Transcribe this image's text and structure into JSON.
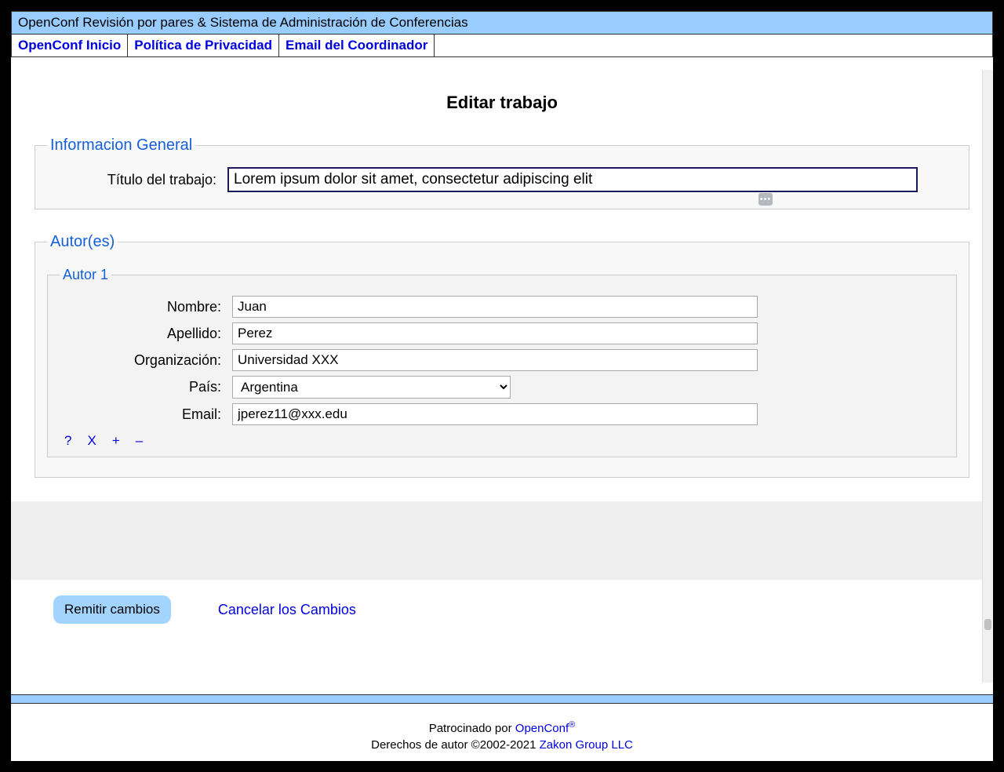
{
  "header": {
    "title": "OpenConf Revisión por pares & Sistema de Administración de Conferencias"
  },
  "nav": {
    "home": "OpenConf Inicio",
    "privacy": "Política de Privacidad",
    "coordinator_email": "Email del Coordinador"
  },
  "page": {
    "title": "Editar trabajo"
  },
  "general_info": {
    "legend": "Informacion General",
    "title_label": "Título del trabajo:",
    "title_value": "Lorem ipsum dolor sit amet, consectetur adipiscing elit"
  },
  "authors": {
    "legend": "Autor(es)",
    "author1": {
      "legend": "Autor 1",
      "name_label": "Nombre:",
      "name_value": "Juan",
      "surname_label": "Apellido:",
      "surname_value": "Perez",
      "org_label": "Organización:",
      "org_value": "Universidad XXX",
      "country_label": "País:",
      "country_value": "Argentina",
      "email_label": "Email:",
      "email_value": "jperez11@xxx.edu"
    },
    "controls": {
      "help": "?",
      "remove": "X",
      "add": "+",
      "minus": "–"
    }
  },
  "actions": {
    "submit": "Remitir cambios",
    "cancel": "Cancelar los Cambios"
  },
  "footer": {
    "sponsored_prefix": "Patrocinado por ",
    "sponsored_link": "OpenConf",
    "copyright_prefix": "Derechos de autor ©2002-2021 ",
    "copyright_link": "Zakon Group LLC"
  }
}
